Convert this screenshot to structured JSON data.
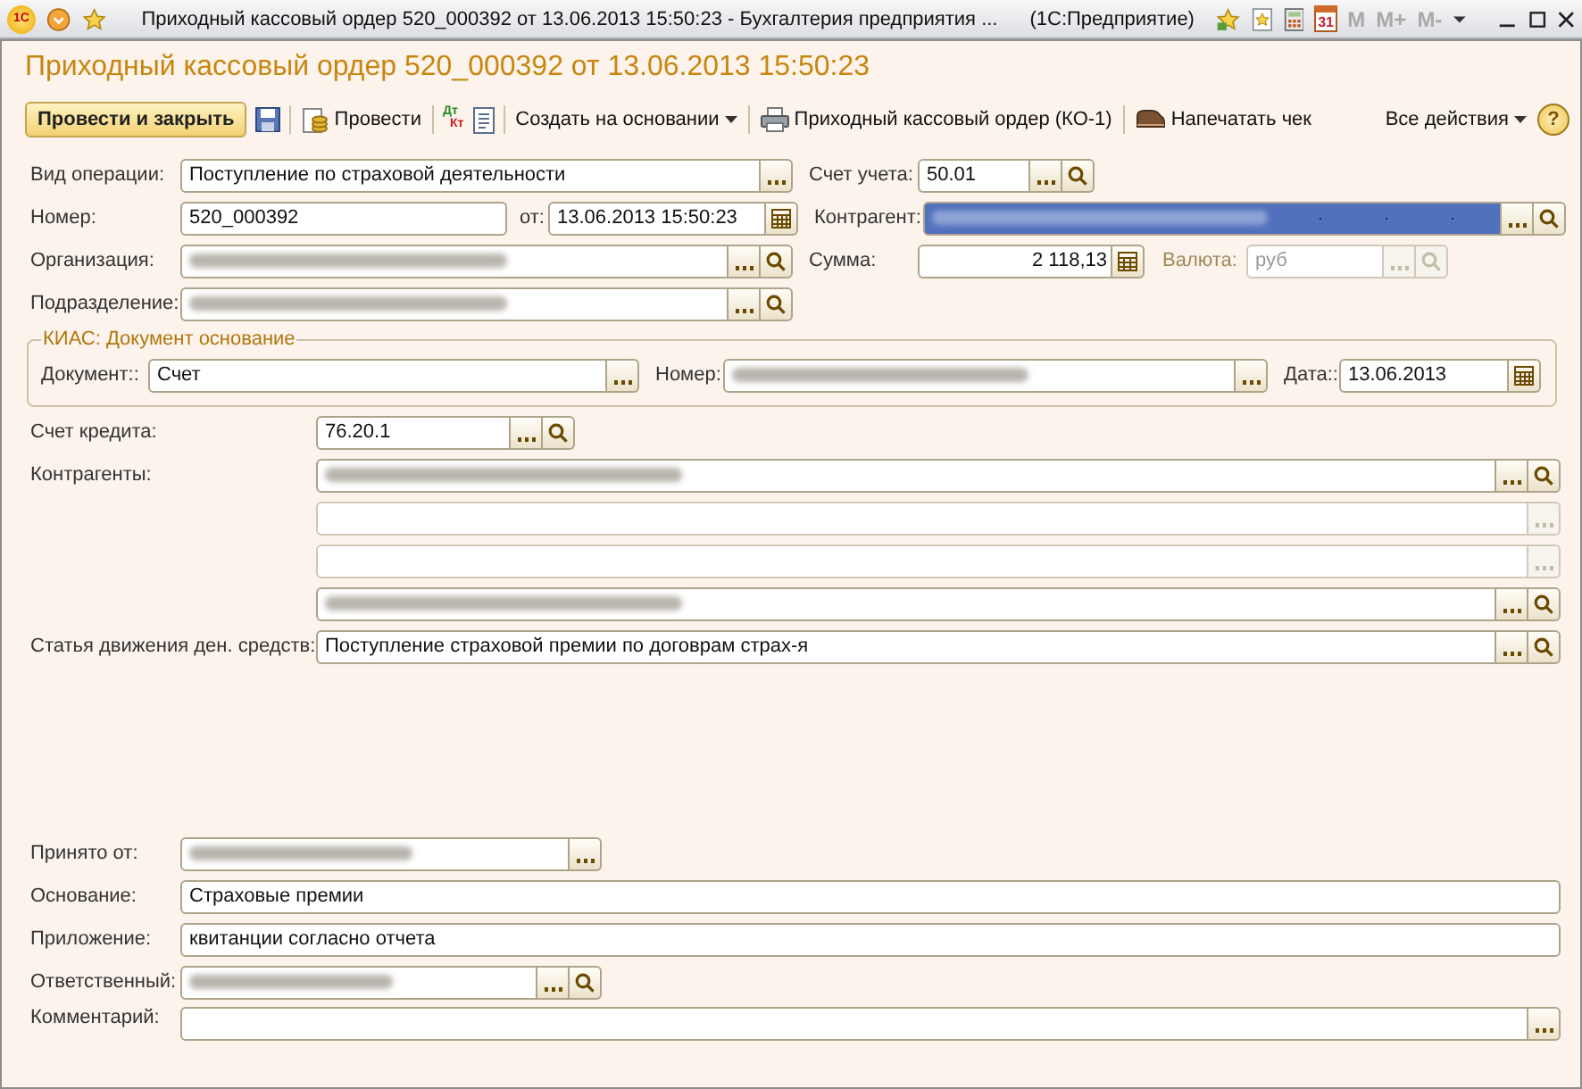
{
  "window": {
    "logo": "1С",
    "title": "Приходный кассовый ордер 520_000392 от 13.06.2013 15:50:23 - Бухгалтерия предприятия ...",
    "app": "(1С:Предприятие)",
    "calendar_day": "31",
    "memory_buttons": [
      {
        "label": "M",
        "disabled": true
      },
      {
        "label": "M+",
        "disabled": true
      },
      {
        "label": "M-",
        "disabled": true
      }
    ]
  },
  "form": {
    "title": "Приходный кассовый ордер 520_000392 от 13.06.2013 15:50:23",
    "toolbar": [
      {
        "kind": "primary",
        "label": "Провести и закрыть"
      },
      {
        "kind": "save"
      },
      {
        "kind": "post",
        "label": "Провести"
      },
      {
        "kind": "dtkt",
        "top": "Дт",
        "bottom": "Кт"
      },
      {
        "kind": "report"
      },
      {
        "kind": "menu",
        "label": "Создать на основании"
      },
      {
        "kind": "print",
        "label": "Приходный кассовый ордер (КО-1)"
      },
      {
        "kind": "receipt",
        "label": "Напечатать чек"
      }
    ],
    "all_actions": "Все действия",
    "help": "?",
    "operation_type": {
      "label": "Вид операции:",
      "value": "Поступление по страховой деятельности",
      "buttons": [
        {
          "kind": "choose"
        }
      ]
    },
    "account": {
      "label": "Счет учета:",
      "value": "50.01",
      "buttons": [
        {
          "kind": "choose"
        },
        {
          "kind": "search"
        }
      ]
    },
    "number": {
      "label": "Номер:",
      "value": "520_000392"
    },
    "date": {
      "label": "от:",
      "value": "13.06.2013 15:50:23",
      "buttons": [
        {
          "kind": "calendar"
        }
      ]
    },
    "counterparty": {
      "label": "Контрагент:",
      "redacted": true,
      "selected": true,
      "buttons": [
        {
          "kind": "choose"
        },
        {
          "kind": "search"
        }
      ]
    },
    "organization": {
      "label": "Организация:",
      "redacted": true,
      "buttons": [
        {
          "kind": "choose"
        },
        {
          "kind": "search"
        }
      ]
    },
    "amount": {
      "label": "Сумма:",
      "value": "2 118,13",
      "buttons": [
        {
          "kind": "calculator"
        }
      ]
    },
    "currency": {
      "label": "Валюта:",
      "value": "руб",
      "disabled": true,
      "buttons": [
        {
          "kind": "choose"
        },
        {
          "kind": "search"
        }
      ]
    },
    "division": {
      "label": "Подразделение:",
      "redacted": true,
      "buttons": [
        {
          "kind": "choose"
        },
        {
          "kind": "search"
        }
      ]
    },
    "basis_document": {
      "title": "КИАС: Документ основание",
      "document": {
        "label": "Документ::",
        "value": "Счет",
        "buttons": [
          {
            "kind": "choose"
          }
        ]
      },
      "number": {
        "label": "Номер:",
        "redacted": true,
        "buttons": [
          {
            "kind": "choose"
          }
        ]
      },
      "date": {
        "label": "Дата::",
        "value": "13.06.2013",
        "buttons": [
          {
            "kind": "calendar"
          }
        ]
      }
    },
    "credit_account": {
      "label": "Счет кредита:",
      "value": "76.20.1",
      "buttons": [
        {
          "kind": "choose"
        },
        {
          "kind": "search"
        }
      ]
    },
    "counterparties": {
      "label": "Контрагенты:",
      "fields": [
        {
          "redacted": true,
          "disabled": false,
          "buttons": [
            {
              "kind": "choose"
            },
            {
              "kind": "search"
            }
          ]
        },
        {
          "redacted": false,
          "disabled": true,
          "buttons": [
            {
              "kind": "choose"
            }
          ]
        },
        {
          "redacted": false,
          "disabled": true,
          "buttons": [
            {
              "kind": "choose"
            }
          ]
        },
        {
          "redacted": true,
          "disabled": false,
          "buttons": [
            {
              "kind": "choose"
            },
            {
              "kind": "search"
            }
          ]
        }
      ]
    },
    "cash_flow_item": {
      "label": "Статья движения ден. средств:",
      "value": "Поступление страховой премии по договрам страх-я",
      "buttons": [
        {
          "kind": "choose"
        },
        {
          "kind": "search"
        }
      ]
    },
    "received_from": {
      "label": "Принято от:",
      "redacted": true,
      "buttons": [
        {
          "kind": "choose"
        }
      ]
    },
    "reason": {
      "label": "Основание:",
      "value": "Страховые премии"
    },
    "attachment": {
      "label": "Приложение:",
      "value": "квитанции согласно отчета"
    },
    "responsible": {
      "label": "Ответственный:",
      "redacted": true,
      "buttons": [
        {
          "kind": "choose"
        },
        {
          "kind": "search"
        }
      ]
    },
    "comment": {
      "label": "Комментарий:",
      "buttons": [
        {
          "kind": "choose"
        }
      ]
    }
  }
}
